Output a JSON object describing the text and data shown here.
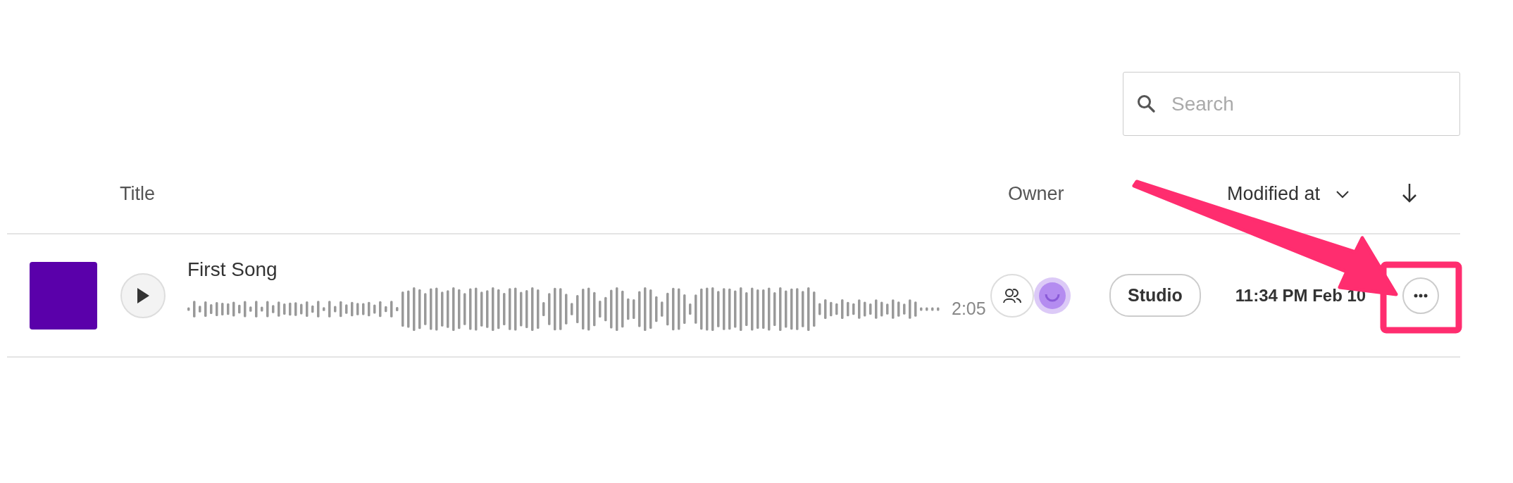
{
  "search": {
    "placeholder": "Search"
  },
  "columns": [
    {
      "kind": "title",
      "label": "Title"
    },
    {
      "kind": "owner",
      "label": "Owner"
    },
    {
      "kind": "modified",
      "label": "Modified at"
    }
  ],
  "sort_descending": true,
  "rows": [
    {
      "title": "First Song",
      "color": "#5a00aa",
      "duration": "2:05",
      "shared": true,
      "badge": "Studio",
      "modified": "11:34 PM Feb 10"
    }
  ]
}
